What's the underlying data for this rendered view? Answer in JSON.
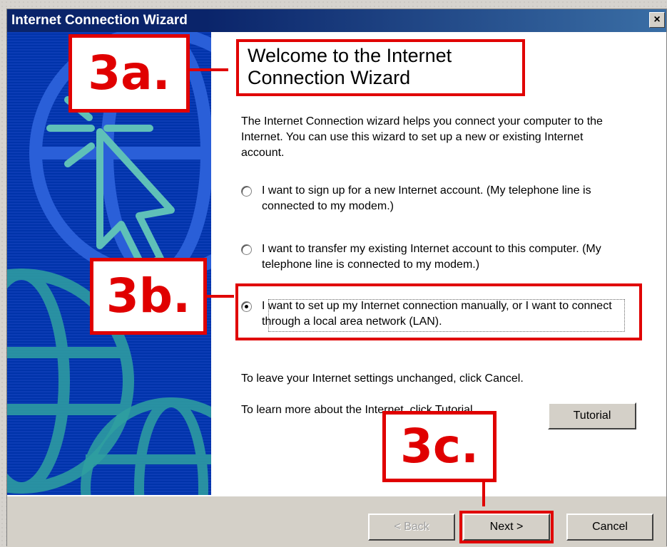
{
  "window": {
    "title": "Internet Connection Wizard",
    "close_label": "×"
  },
  "wizard": {
    "heading_line1": "Welcome to the Internet",
    "heading_line2": "Connection Wizard",
    "intro": "The Internet Connection wizard helps you connect your computer to the Internet.  You can use this wizard to set up a new or existing Internet account.",
    "options": [
      {
        "label": "I want to sign up for a new Internet account. (My telephone line is connected to my modem.)",
        "checked": false
      },
      {
        "label": "I want to transfer my existing Internet account to this computer. (My telephone line is connected to my modem.)",
        "checked": false
      },
      {
        "label": "I want to set up my Internet connection manually, or I want to connect through a local area network (LAN).",
        "checked": true
      }
    ],
    "leave_text": "To leave your Internet settings unchanged, click Cancel.",
    "learn_text": "To learn more about the Internet, click Tutorial.",
    "tutorial_label": "Tutorial"
  },
  "buttons": {
    "back_label": "< Back",
    "next_label": "Next >",
    "cancel_label": "Cancel"
  },
  "annotations": {
    "step_a": "3a.",
    "step_b": "3b.",
    "step_c": "3c."
  },
  "colors": {
    "annotation_red": "#e00000",
    "side_panel_blue": "#0033aa",
    "titlebar_blue": "#0a246a"
  }
}
